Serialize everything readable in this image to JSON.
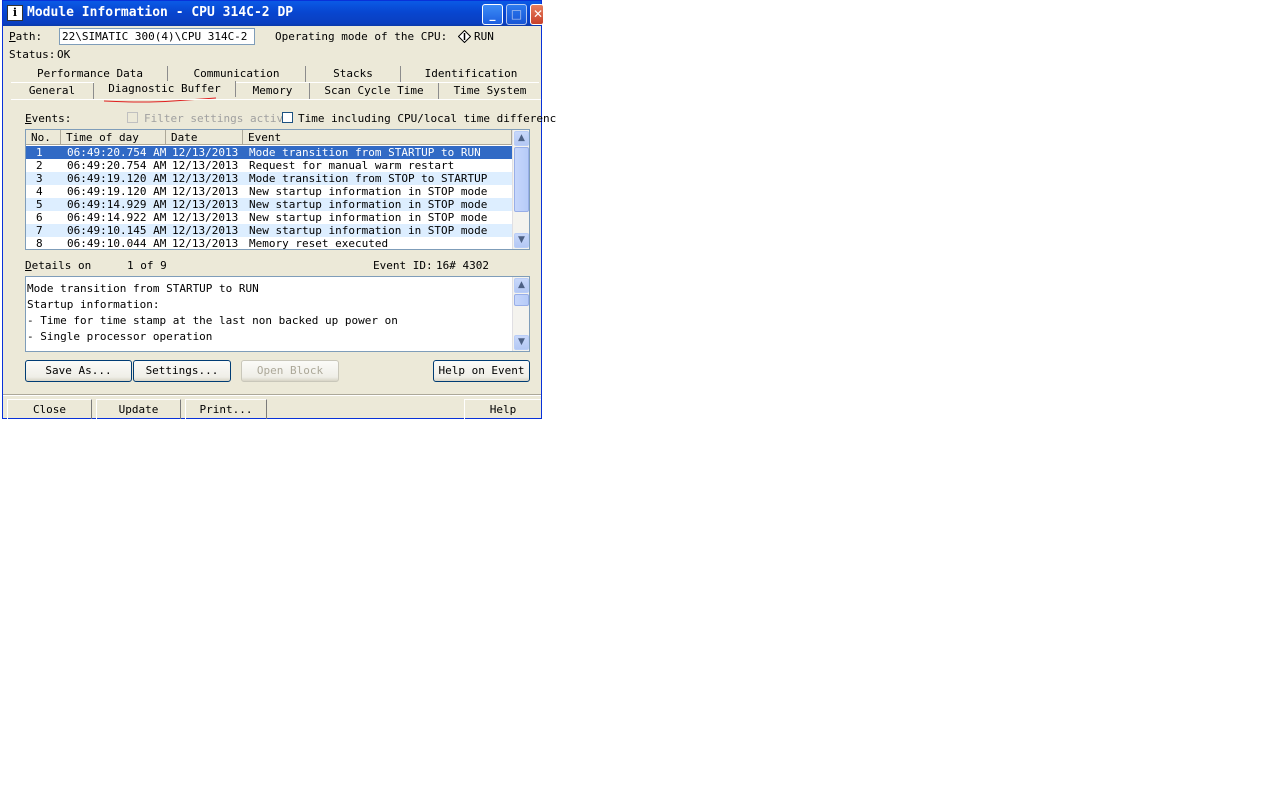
{
  "window": {
    "title": "Module Information - CPU 314C-2 DP"
  },
  "top": {
    "path_label": "Path:",
    "path_value": "22\\SIMATIC 300(4)\\CPU 314C-2 DP",
    "mode_label": "Operating mode of the  CPU:",
    "mode_value": "RUN",
    "status_label": "Status:",
    "status_value": "OK"
  },
  "tabs_row1": [
    "Performance Data",
    "Communication",
    "Stacks",
    "Identification"
  ],
  "tabs_row2": [
    "General",
    "Diagnostic Buffer",
    "Memory",
    "Scan Cycle Time",
    "Time System"
  ],
  "active_tab": "Diagnostic Buffer",
  "events": {
    "label": "Events:",
    "filter_label": "Filter settings activ",
    "time_label": "Time including CPU/local time differenc",
    "columns": [
      "No.",
      "Time of day",
      "Date",
      "Event"
    ],
    "rows": [
      {
        "no": "1",
        "time": "06:49:20.754 AM",
        "date": "12/13/2013",
        "event": "Mode transition from STARTUP to RUN"
      },
      {
        "no": "2",
        "time": "06:49:20.754 AM",
        "date": "12/13/2013",
        "event": "Request for manual warm restart"
      },
      {
        "no": "3",
        "time": "06:49:19.120 AM",
        "date": "12/13/2013",
        "event": "Mode transition from STOP to STARTUP"
      },
      {
        "no": "4",
        "time": "06:49:19.120 AM",
        "date": "12/13/2013",
        "event": "New startup information in STOP mode"
      },
      {
        "no": "5",
        "time": "06:49:14.929 AM",
        "date": "12/13/2013",
        "event": "New startup information in STOP mode"
      },
      {
        "no": "6",
        "time": "06:49:14.922 AM",
        "date": "12/13/2013",
        "event": "New startup information in STOP mode"
      },
      {
        "no": "7",
        "time": "06:49:10.145 AM",
        "date": "12/13/2013",
        "event": "New startup information in STOP mode"
      },
      {
        "no": "8",
        "time": "06:49:10.044 AM",
        "date": "12/13/2013",
        "event": "Memory reset executed"
      }
    ]
  },
  "details": {
    "label": "Details on",
    "position": "1 of 9",
    "event_id_label": "Event ID:",
    "event_id_value": "16# 4302",
    "lines": [
      "Mode transition from STARTUP to RUN",
      "Startup information:",
      "- Time for time stamp at the last non backed up power on",
      "- Single processor operation"
    ]
  },
  "buttons": {
    "save_as": "Save As...",
    "settings": "Settings...",
    "open_block": "Open Block",
    "help_on_event": "Help on Event"
  },
  "footer": {
    "close": "Close",
    "update": "Update",
    "print": "Print...",
    "help": "Help"
  }
}
